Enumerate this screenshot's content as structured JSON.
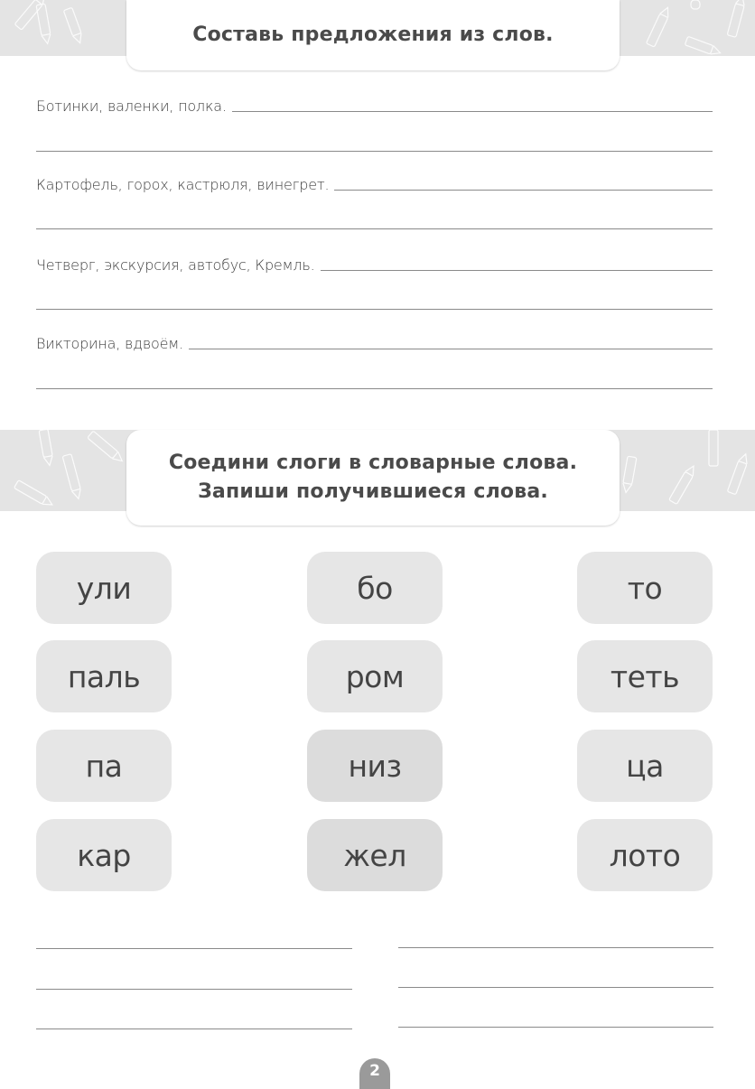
{
  "section1": {
    "title": "Составь предложения из слов.",
    "prompts": [
      "Ботинки, валенки, полка.",
      "Картофель, горох, кастрюля, винегрет.",
      "Четверг, экскурсия, автобус, Кремль.",
      "Викторина, вдвоём."
    ]
  },
  "section2": {
    "title_line1": "Соедини слоги в словарные слова.",
    "title_line2": "Запиши получившиеся слова.",
    "syllables": {
      "column1": [
        "ули",
        "паль",
        "па",
        "кар"
      ],
      "column2": [
        "бо",
        "ром",
        "низ",
        "жел"
      ],
      "column3": [
        "то",
        "теть",
        "ца",
        "лото"
      ]
    }
  },
  "page_number": "2",
  "colors": {
    "band": "#e4e4e4",
    "tile": "#e6e6e6",
    "text": "#3c3c3c",
    "page_badge": "#9a9a9a"
  }
}
